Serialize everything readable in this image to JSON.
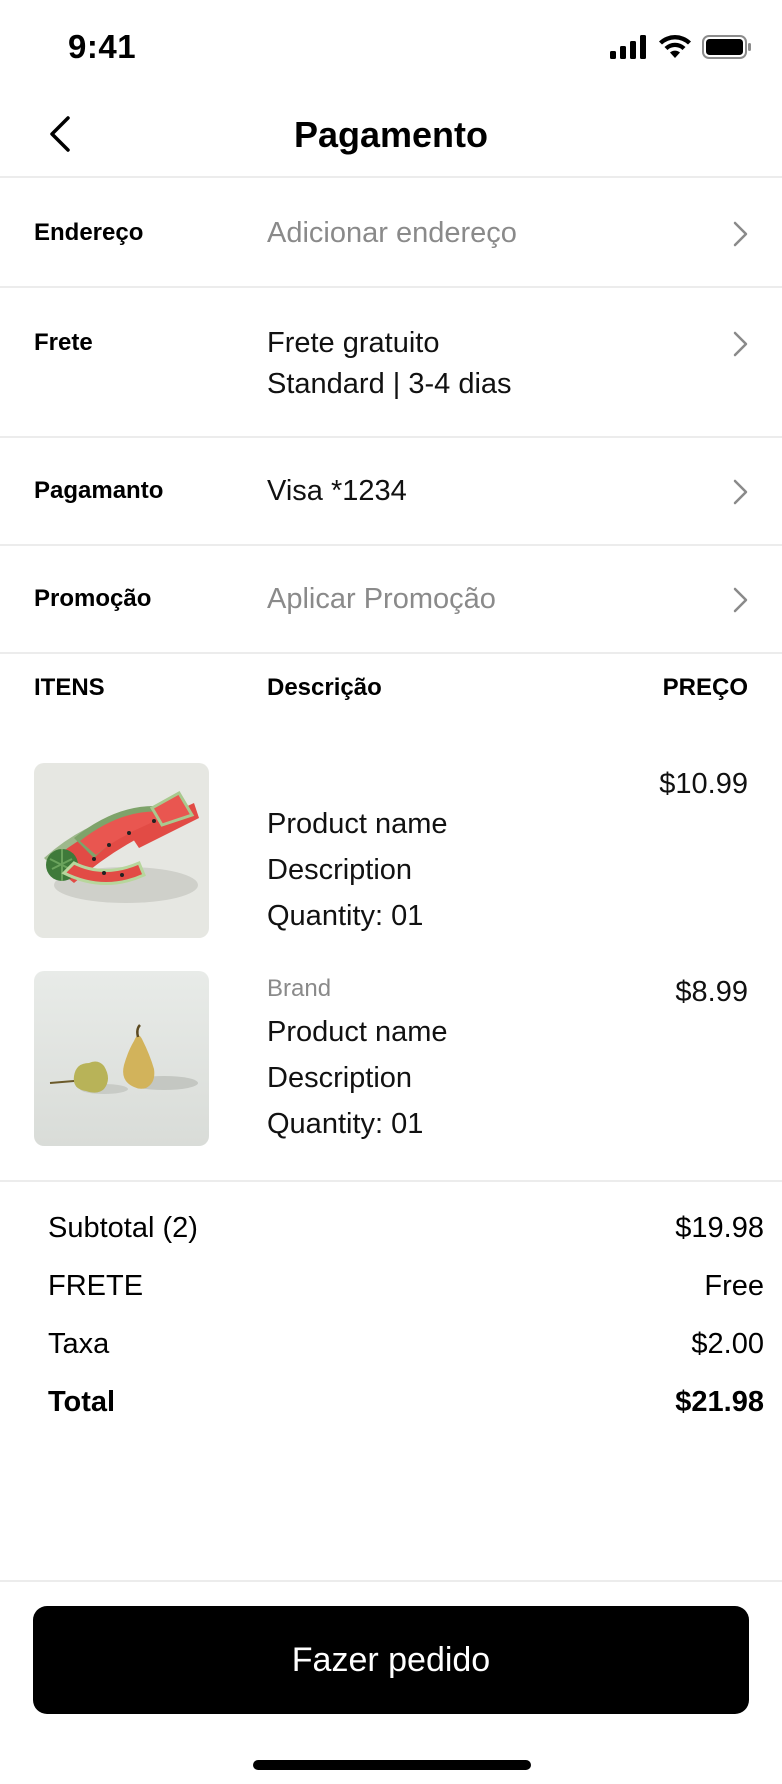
{
  "status": {
    "time": "9:41"
  },
  "header": {
    "title": "Pagamento"
  },
  "rows": [
    {
      "label": "Endereço",
      "value": "Adicionar endereço",
      "placeholder": true
    },
    {
      "label": "Frete",
      "value_line1": "Frete gratuito",
      "value_line2": "Standard | 3-4 dias"
    },
    {
      "label": "Pagamanto",
      "value": "Visa *1234"
    },
    {
      "label": "Promoção",
      "value": "Aplicar Promoção",
      "placeholder": true
    }
  ],
  "items_header": {
    "items": "ITENS",
    "description": "Descrição",
    "price": "PREÇO"
  },
  "items": [
    {
      "brand": "",
      "name": "Product name",
      "description": "Description",
      "quantity": "Quantity: 01",
      "price": "$10.99",
      "image": "watermelon-image"
    },
    {
      "brand": "Brand",
      "name": "Product name",
      "description": "Description",
      "quantity": "Quantity: 01",
      "price": "$8.99",
      "image": "pears-image"
    }
  ],
  "summary": {
    "subtotal_label": "Subtotal (2)",
    "subtotal_value": "$19.98",
    "shipping_label": "FRETE",
    "shipping_value": "Free",
    "tax_label": "Taxa",
    "tax_value": "$2.00",
    "total_label": "Total",
    "total_value": "$21.98"
  },
  "cta": {
    "label": "Fazer pedido"
  },
  "colors": {
    "accent": "#000000",
    "placeholder": "#8a8a8a",
    "divider": "#ececec"
  }
}
